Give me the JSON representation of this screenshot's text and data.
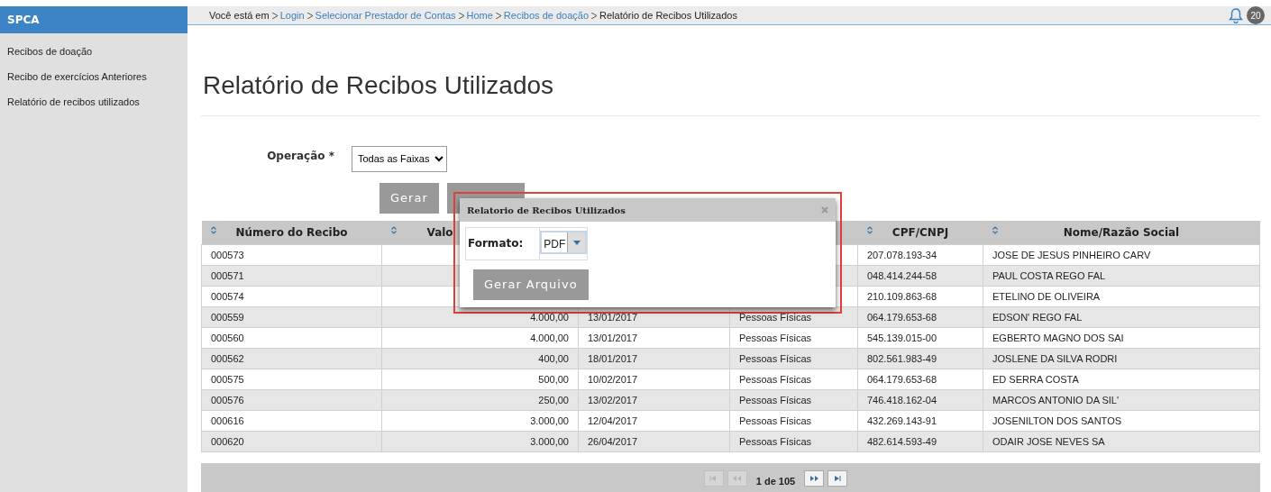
{
  "app": {
    "brand": "SPCA"
  },
  "breadcrumb": [
    {
      "label": "Você está em",
      "link": false
    },
    {
      "label": "Login",
      "link": true
    },
    {
      "label": "Selecionar Prestador de Contas",
      "link": true
    },
    {
      "label": "Home",
      "link": true
    },
    {
      "label": "Recibos de doação",
      "link": true
    },
    {
      "label": "Relatório de Recibos Utilizados",
      "link": false
    }
  ],
  "notifications": {
    "count": "20"
  },
  "sidebar": {
    "items": [
      "Recibos de doação",
      "Recibo de exercícios Anteriores",
      "Relatório de recibos utilizados"
    ]
  },
  "page_title": "Relatório de Recibos Utilizados",
  "form": {
    "label": "Operação *",
    "select_value": "Todas as Faixas",
    "buttons": [
      {
        "kind": "labeled",
        "label": "Gerar"
      },
      {
        "kind": "blank"
      }
    ]
  },
  "table": {
    "columns": [
      "Número do Recibo",
      "Valo",
      null,
      null,
      "CPF/CNPJ",
      "Nome/Razão Social"
    ],
    "rows": [
      [
        "000573",
        null,
        null,
        null,
        "207.078.193-34",
        "JOSE DE JESUS PINHEIRO CARV"
      ],
      [
        "000571",
        null,
        null,
        null,
        "048.414.244-58",
        "PAUL COSTA REGO FAL"
      ],
      [
        "000574",
        null,
        null,
        null,
        "210.109.863-68",
        "ETELINO DE OLIVEIRA"
      ],
      [
        "000559",
        "4.000,00",
        "13/01/2017",
        "Pessoas Físicas",
        "064.179.653-68",
        "EDSON' REGO FAL"
      ],
      [
        "000560",
        "4.000,00",
        "13/01/2017",
        "Pessoas Físicas",
        "545.139.015-00",
        "EGBERTO MAGNO DOS SAI"
      ],
      [
        "000562",
        "400,00",
        "18/01/2017",
        "Pessoas Físicas",
        "802.561.983-49",
        "JOSLENE DA SILVA RODRI"
      ],
      [
        "000575",
        "500,00",
        "10/02/2017",
        "Pessoas Físicas",
        "064.179.653-68",
        "ED SERRA COSTA"
      ],
      [
        "000576",
        "250,00",
        "13/02/2017",
        "Pessoas Físicas",
        "746.418.162-04",
        "MARCOS ANTONIO DA SIL'"
      ],
      [
        "000616",
        "3.000,00",
        "12/04/2017",
        "Pessoas Físicas",
        "432.269.143-91",
        "JOSENILTON DOS SANTOS"
      ],
      [
        "000620",
        "3.000,00",
        "26/04/2017",
        "Pessoas Físicas",
        "482.614.593-49",
        "ODAIR JOSE NEVES SA"
      ]
    ]
  },
  "pager": {
    "buttons": [
      {
        "kind": "first",
        "disabled": true
      },
      {
        "kind": "prev",
        "disabled": true
      },
      {
        "kind": "next",
        "disabled": false
      },
      {
        "kind": "last",
        "disabled": false
      }
    ],
    "text": "1 de 105"
  },
  "dialog": {
    "title": "Relatorio de Recibos Utilizados",
    "field_label": "Formato:",
    "select_value": "PDF",
    "button": "Gerar Arquivo"
  }
}
